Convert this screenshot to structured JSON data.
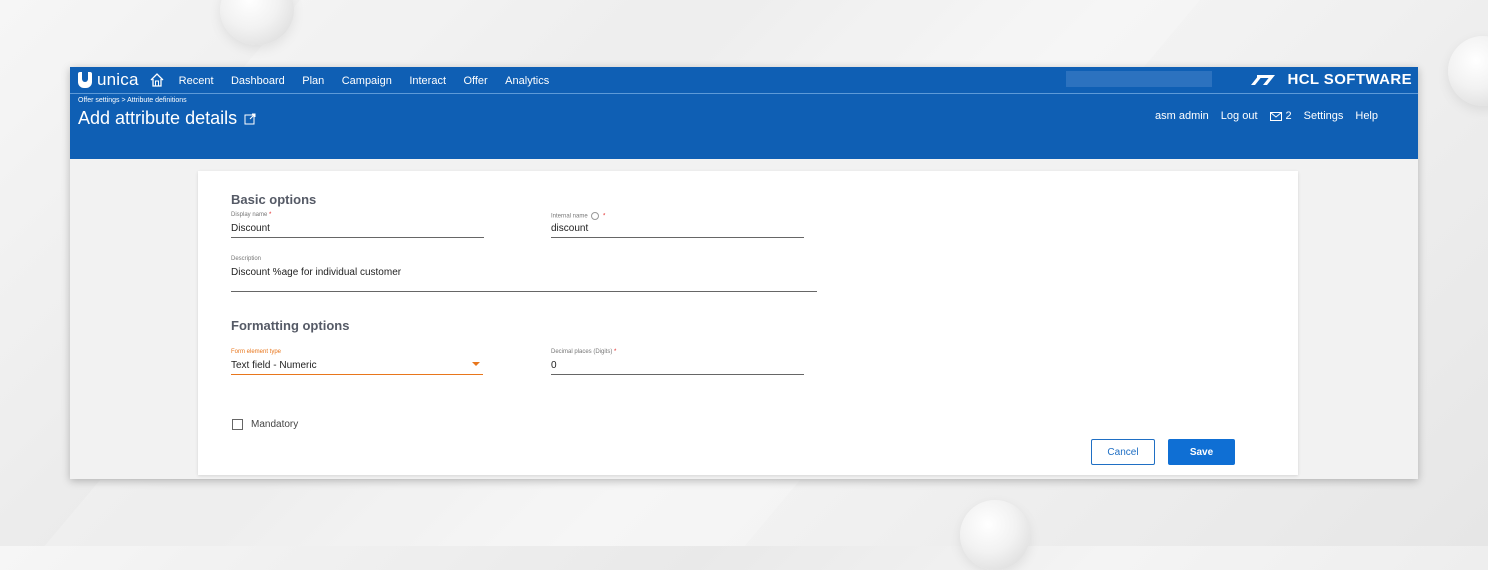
{
  "topbar": {
    "logo_text": "unica",
    "nav": [
      "Recent",
      "Dashboard",
      "Plan",
      "Campaign",
      "Interact",
      "Offer",
      "Analytics"
    ],
    "brand": "HCL SOFTWARE",
    "icons": [
      "unica-logo-icon",
      "home-icon",
      "hcl-logo-icon"
    ]
  },
  "header": {
    "breadcrumb": "Offer settings > Attribute definitions",
    "title": "Add attribute details",
    "user": "asm admin",
    "logout": "Log out",
    "mail_count": "2",
    "settings": "Settings",
    "help": "Help"
  },
  "form": {
    "basic_title": "Basic options",
    "display_name": {
      "label": "Display name",
      "value": "Discount",
      "required_mark": "*"
    },
    "internal_name": {
      "label": "Internal name",
      "value": "discount",
      "required_mark": "*"
    },
    "description": {
      "label": "Description",
      "value": "Discount %age for individual customer"
    },
    "formatting_title": "Formatting options",
    "form_element_type": {
      "label": "Form element type",
      "value": "Text field - Numeric"
    },
    "decimal_places": {
      "label": "Decimal places (Digits)",
      "value": "0",
      "required_mark": "*"
    },
    "mandatory_label": "Mandatory",
    "cancel_label": "Cancel",
    "save_label": "Save"
  },
  "colors": {
    "primary": "#0f5fb4",
    "accent_orange": "#e8761c",
    "required_red": "#e02020"
  }
}
